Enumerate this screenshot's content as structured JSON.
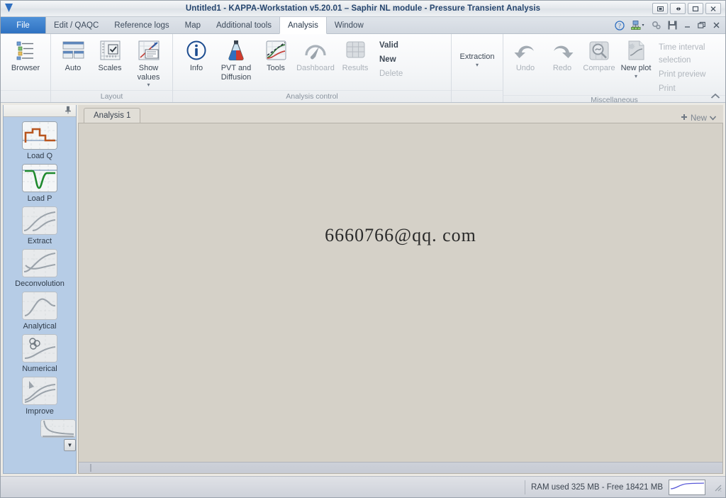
{
  "window": {
    "title": "Untitled1 - KAPPA-Workstation v5.20.01 – Saphir NL module - Pressure Transient Analysis",
    "logo_icon": "kappa-logo-icon",
    "buttons": [
      {
        "name": "screenshot-button",
        "glyph": "⬚"
      },
      {
        "name": "resize-width-button",
        "glyph": "↔"
      },
      {
        "name": "maximize-button",
        "glyph": "□"
      },
      {
        "name": "close-button",
        "glyph": "✕"
      }
    ]
  },
  "menubar": {
    "file_label": "File",
    "items": [
      {
        "label": "Edit / QAQC",
        "active": false
      },
      {
        "label": "Reference logs",
        "active": false
      },
      {
        "label": "Map",
        "active": false
      },
      {
        "label": "Additional tools",
        "active": false
      },
      {
        "label": "Analysis",
        "active": true
      },
      {
        "label": "Window",
        "active": false
      }
    ],
    "right_icons": [
      "help-icon",
      "network-icon",
      "settings-gears-icon",
      "save-icon",
      "minimize-icon",
      "restore-icon",
      "close-icon"
    ]
  },
  "ribbon": {
    "groups": [
      {
        "label": "",
        "buttons": [
          {
            "label": "Browser",
            "icon": "browser-tree-icon",
            "disabled": false,
            "caret": false
          }
        ]
      },
      {
        "label": "Layout",
        "buttons": [
          {
            "label": "Auto",
            "icon": "auto-layout-icon",
            "disabled": false,
            "caret": false
          },
          {
            "label": "Scales",
            "icon": "scales-icon",
            "disabled": false,
            "caret": false
          },
          {
            "label": "Show values",
            "icon": "show-values-icon",
            "disabled": false,
            "caret": true
          }
        ]
      },
      {
        "label": "Analysis control",
        "buttons": [
          {
            "label": "Info",
            "icon": "info-icon",
            "disabled": false,
            "caret": false
          },
          {
            "label": "PVT and Diffusion",
            "icon": "pvt-flask-icon",
            "disabled": false,
            "caret": false
          },
          {
            "label": "Tools",
            "icon": "tools-chart-icon",
            "disabled": false,
            "caret": false
          },
          {
            "label": "Dashboard",
            "icon": "dashboard-gauge-icon",
            "disabled": true,
            "caret": false
          },
          {
            "label": "Results",
            "icon": "results-table-icon",
            "disabled": true,
            "caret": false
          }
        ],
        "stack": [
          {
            "label": "Valid",
            "disabled": false
          },
          {
            "label": "New",
            "disabled": false
          },
          {
            "label": "Delete",
            "disabled": true
          }
        ]
      },
      {
        "label": "",
        "buttons": [
          {
            "label": "Extraction",
            "icon": "",
            "disabled": false,
            "caret": true
          }
        ]
      },
      {
        "label": "Miscellaneous",
        "buttons": [
          {
            "label": "Undo",
            "icon": "undo-icon",
            "disabled": true,
            "caret": false
          },
          {
            "label": "Redo",
            "icon": "redo-icon",
            "disabled": true,
            "caret": false
          },
          {
            "label": "Compare",
            "icon": "compare-icon",
            "disabled": true,
            "caret": false
          },
          {
            "label": "New plot",
            "icon": "new-plot-icon",
            "disabled": true,
            "caret": true
          }
        ],
        "stack": [
          {
            "label": "Time interval selection",
            "disabled": true
          },
          {
            "label": "Print preview",
            "disabled": true
          },
          {
            "label": "Print",
            "disabled": true
          }
        ]
      }
    ],
    "collapse_icon": "chevron-up-icon"
  },
  "sidebar": {
    "pin_icon": "pin-icon",
    "items": [
      {
        "label": "Load Q",
        "icon": "load-q-icon",
        "active": true
      },
      {
        "label": "Load P",
        "icon": "load-p-icon",
        "active": true
      },
      {
        "label": "Extract",
        "icon": "extract-icon",
        "active": false
      },
      {
        "label": "Deconvolution",
        "icon": "deconvolution-icon",
        "active": false
      },
      {
        "label": "Analytical",
        "icon": "analytical-icon",
        "active": false
      },
      {
        "label": "Numerical",
        "icon": "numerical-icon",
        "active": false
      },
      {
        "label": "Improve",
        "icon": "improve-icon",
        "active": false
      }
    ],
    "more_icon": "chevron-down-icon",
    "partial_icon": "decline-curve-icon"
  },
  "main": {
    "tabs": [
      {
        "label": "Analysis 1",
        "active": true
      }
    ],
    "new_tab_label": "New",
    "new_tab_plus": "➕",
    "new_tab_caret": "▾",
    "watermark": "6660766@qq. com"
  },
  "statusbar": {
    "ram_text": "RAM used 325 MB - Free 18421 MB",
    "graph_name": "ram-usage-graph",
    "graph_color": "#5a5ad8"
  }
}
